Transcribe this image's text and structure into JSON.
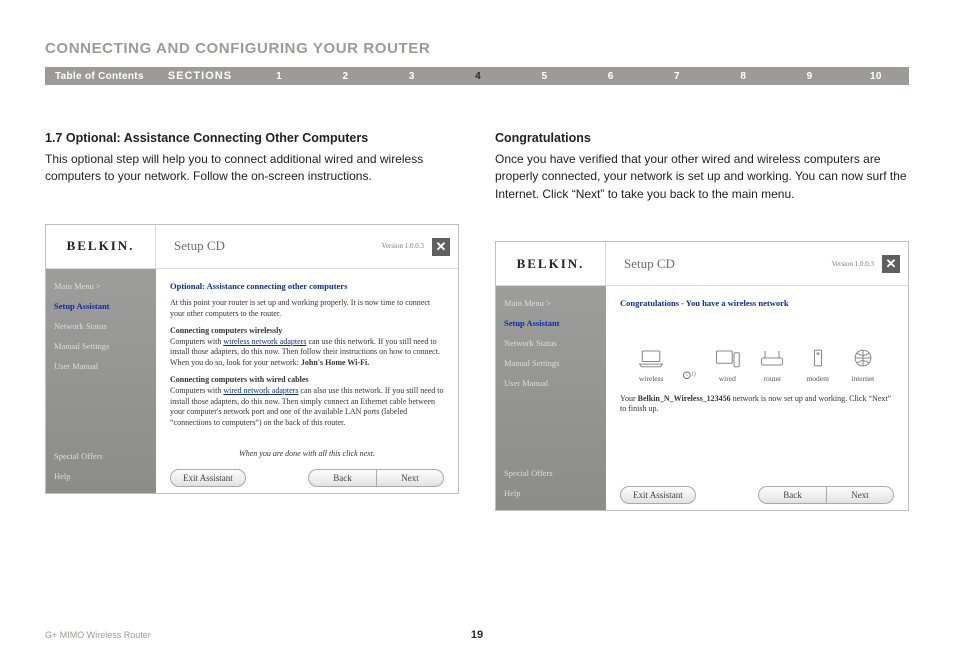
{
  "page": {
    "title": "CONNECTING AND CONFIGURING YOUR ROUTER",
    "footer_model": "G+ MIMO Wireless Router",
    "page_number": "19"
  },
  "nav": {
    "toc": "Table of Contents",
    "sections": "SECTIONS",
    "numbers": [
      "1",
      "2",
      "3",
      "4",
      "5",
      "6",
      "7",
      "8",
      "9",
      "10"
    ],
    "active": "4"
  },
  "left": {
    "heading": "1.7 Optional: Assistance Connecting Other Computers",
    "text": "This optional step will help you to connect additional wired and wireless computers to your network. Follow the on-screen instructions."
  },
  "right": {
    "heading": "Congratulations",
    "text": "Once you have verified that your other wired and wireless computers are properly connected, your network is set up and working. You can now surf the Internet. Click “Next” to take you back to the main menu."
  },
  "app_common": {
    "brand": "BELKIN.",
    "setup": "Setup CD",
    "version": "Version 1.0.0.3",
    "sidebar_top": {
      "mainmenu": "Main Menu  >",
      "assistant": "Setup Assistant",
      "status": "Network Status",
      "manualset": "Manual Settings",
      "usermanual": "User Manual"
    },
    "sidebar_bottom": {
      "offers": "Special Offers",
      "help": "Help"
    },
    "buttons": {
      "exit": "Exit Assistant",
      "back": "Back",
      "next": "Next"
    }
  },
  "app_left": {
    "title": "Optional: Assistance connecting other computers",
    "p1": "At this point your router is set up and working properly. It is now time to connect your other computers to the router.",
    "h2": "Connecting computers wirelessly",
    "p2a": "Computers with ",
    "p2link": "wireless network adapters",
    "p2b": " can use this network. If you still need to install those adapters, do this now. Then follow their instructions on how to connect. When you do so, look for your network: ",
    "p2net": "John's Home Wi-Fi.",
    "h3": "Connecting computers with wired cables",
    "p3a": "Computers with ",
    "p3link": "wired network adapters",
    "p3b": " can also use this network. If you still need to install those adapters, do this now. Then simply connect an Ethernet cable between your computer's network port and one of the available LAN ports (labeled “connections to computers”) on the back of this router.",
    "note": "When you are done with all this click next."
  },
  "app_right": {
    "title": "Congratulations - You have a wireless network",
    "devices": {
      "wireless": "wireless",
      "wired": "wired",
      "router": "router",
      "modem": "modem",
      "internet": "internet"
    },
    "msg_a": "Your ",
    "msg_net": "Belkin_N_Wireless_123456",
    "msg_b": " network is now set up and working. Click “Next” to finish up."
  }
}
